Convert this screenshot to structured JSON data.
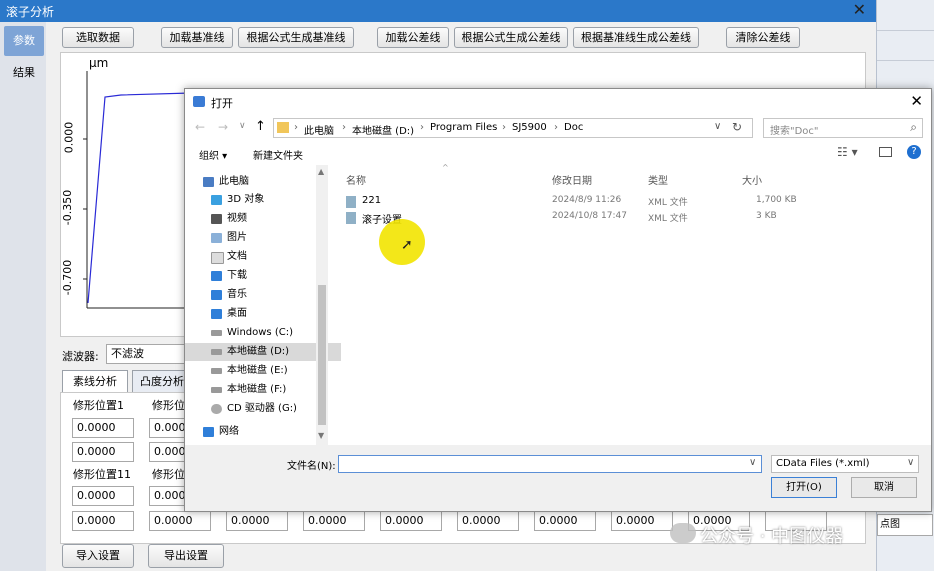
{
  "app": {
    "title": "滚子分析",
    "nav": [
      "参数",
      "结果"
    ],
    "toolbar": [
      "选取数据",
      "加载基准线",
      "根据公式生成基准线",
      "加载公差线",
      "根据公式生成公差线",
      "根据基准线生成公差线",
      "清除公差线"
    ],
    "plot": {
      "unit": "μm",
      "yticks": [
        "0.000",
        "-0.350",
        "-0.700"
      ]
    },
    "filter_label": "滤波器:",
    "filter_value": "不滤波",
    "tabs": [
      "素线分析",
      "凸度分析"
    ],
    "row_labels_1": [
      "修形位置1",
      "修形位"
    ],
    "row_labels_2": [
      "修形位置11",
      "修形位"
    ],
    "fields_col1": [
      "0.0000",
      "0.0000",
      "0.0000",
      "0.0000"
    ],
    "fields_col2": [
      "0.000",
      "0.000",
      "0.000",
      "0.0000"
    ],
    "bottom_row": [
      "0.0000",
      "0.0000",
      "0.0000",
      "0.0000",
      "0.0000",
      "0.0000",
      "0.0000",
      "0.0000",
      "0.0000"
    ],
    "import_button": "导入设置",
    "export_button": "导出设置",
    "right_cut_label": "点图"
  },
  "dialog": {
    "title": "打开",
    "breadcrumb": [
      "此电脑",
      "本地磁盘 (D:)",
      "Program Files",
      "SJ5900",
      "Doc"
    ],
    "search_placeholder": "搜索\"Doc\"",
    "organize": "组织 ▾",
    "new_folder": "新建文件夹",
    "tree": [
      {
        "label": "此电脑",
        "icon": "computer-icon"
      },
      {
        "label": "3D 对象",
        "icon": "3d-objects-icon"
      },
      {
        "label": "视频",
        "icon": "video-icon"
      },
      {
        "label": "图片",
        "icon": "pictures-icon"
      },
      {
        "label": "文档",
        "icon": "documents-icon"
      },
      {
        "label": "下载",
        "icon": "download-icon"
      },
      {
        "label": "音乐",
        "icon": "music-icon"
      },
      {
        "label": "桌面",
        "icon": "desktop-icon"
      },
      {
        "label": "Windows (C:)",
        "icon": "drive-icon"
      },
      {
        "label": "本地磁盘 (D:)",
        "icon": "drive-icon"
      },
      {
        "label": "本地磁盘 (E:)",
        "icon": "drive-icon"
      },
      {
        "label": "本地磁盘 (F:)",
        "icon": "drive-icon"
      },
      {
        "label": "CD 驱动器 (G:)",
        "icon": "cd-drive-icon"
      },
      {
        "label": "网络",
        "icon": "network-icon"
      }
    ],
    "columns": [
      "名称",
      "修改日期",
      "类型",
      "大小"
    ],
    "files": [
      {
        "name": "221",
        "date": "2024/8/9 11:26",
        "type": "XML 文件",
        "size": "1,700 KB"
      },
      {
        "name": "滚子设置",
        "date": "2024/10/8 17:47",
        "type": "XML 文件",
        "size": "3 KB"
      }
    ],
    "filename_label": "文件名(N):",
    "filename_value": "",
    "filter_value": "CData Files (*.xml)",
    "open_button": "打开(O)",
    "cancel_button": "取消"
  },
  "watermark": "公众号 · 中图仪器",
  "colors": {
    "titlebar": "#2b78c9",
    "curve": "#2a2ad6",
    "cursor_highlight": "#f2e400"
  }
}
